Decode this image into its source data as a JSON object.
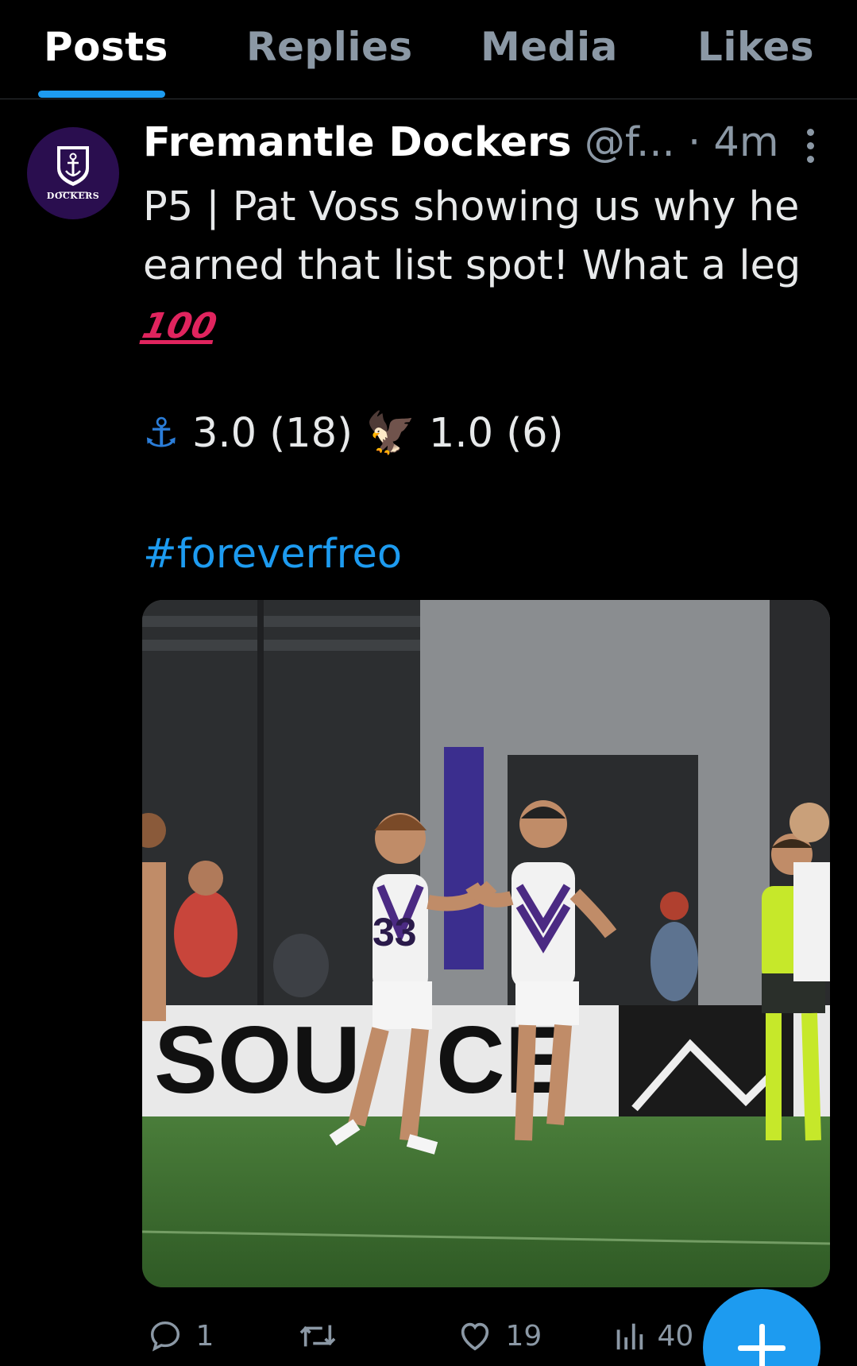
{
  "tabs": {
    "items": [
      {
        "label": "Posts",
        "active": true
      },
      {
        "label": "Replies",
        "active": false
      },
      {
        "label": "Media",
        "active": false
      },
      {
        "label": "Likes",
        "active": false
      }
    ]
  },
  "post": {
    "author_name": "Fremantle Dockers",
    "author_handle": "@f...",
    "separator": "·",
    "time": "4m",
    "avatar_text": "DOCKERS",
    "text_lines": [
      "P5 | Pat Voss showing us why he",
      "earned that list spot! What a leg"
    ],
    "emoji_100": "100",
    "score": {
      "anchor_emoji": "⚓",
      "home": "3.0 (18)",
      "eagle_emoji": "🦅",
      "away": "1.0 (6)"
    },
    "hashtag": "#foreverfreo",
    "actions": {
      "replies": "1",
      "retweets": "",
      "likes": "19",
      "views": "40"
    }
  },
  "colors": {
    "accent": "#1d9bf0",
    "background": "#000000",
    "secondary_text": "#8b98a5",
    "avatar_bg": "#2a0e4f"
  },
  "icons": {
    "more": "more-vertical-icon",
    "reply": "reply-icon",
    "retweet": "retweet-icon",
    "like": "heart-icon",
    "views": "views-icon",
    "compose": "plus-icon"
  }
}
